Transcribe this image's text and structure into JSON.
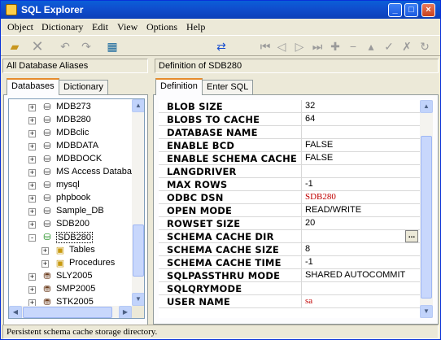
{
  "window": {
    "title": "SQL Explorer"
  },
  "menu": [
    "Object",
    "Dictionary",
    "Edit",
    "View",
    "Options",
    "Help"
  ],
  "toolbar": {
    "icons": [
      "open-folder-icon",
      "delete-icon",
      "undo-icon",
      "redo-icon",
      "dbdesk-icon",
      "synchronize-icon",
      "first-icon",
      "prior-icon",
      "next-icon",
      "last-icon",
      "insert-icon",
      "remove-icon",
      "edit-icon",
      "post-icon",
      "cancel-icon",
      "refresh-icon"
    ]
  },
  "left": {
    "header": "All Database Aliases",
    "tabs": [
      "Databases",
      "Dictionary"
    ],
    "tree": [
      {
        "label": "MDB273",
        "expander": "+",
        "type": "db"
      },
      {
        "label": "MDB280",
        "expander": "+",
        "type": "db"
      },
      {
        "label": "MDBclic",
        "expander": "+",
        "type": "db"
      },
      {
        "label": "MDBDATA",
        "expander": "+",
        "type": "db"
      },
      {
        "label": "MDBDOCK",
        "expander": "+",
        "type": "db"
      },
      {
        "label": "MS Access Databa",
        "expander": "+",
        "type": "db"
      },
      {
        "label": "mysql",
        "expander": "+",
        "type": "db"
      },
      {
        "label": "phpbook",
        "expander": "+",
        "type": "db"
      },
      {
        "label": "Sample_DB",
        "expander": "+",
        "type": "db"
      },
      {
        "label": "SDB200",
        "expander": "+",
        "type": "db"
      },
      {
        "label": "SDB280",
        "expander": "-",
        "type": "db-open"
      },
      {
        "label": "Tables",
        "expander": "+",
        "type": "folder",
        "child": true
      },
      {
        "label": "Procedures",
        "expander": "+",
        "type": "folder",
        "child": true
      },
      {
        "label": "SLY2005",
        "expander": "+",
        "type": "server"
      },
      {
        "label": "SMP2005",
        "expander": "+",
        "type": "server"
      },
      {
        "label": "STK2005",
        "expander": "+",
        "type": "server"
      }
    ]
  },
  "right": {
    "header": "Definition of SDB280",
    "tabs": [
      "Definition",
      "Enter SQL"
    ],
    "rows": [
      {
        "key": "BLOB SIZE",
        "value": "32"
      },
      {
        "key": "BLOBS TO CACHE",
        "value": "64"
      },
      {
        "key": "DATABASE NAME",
        "value": ""
      },
      {
        "key": "ENABLE BCD",
        "value": "FALSE"
      },
      {
        "key": "ENABLE SCHEMA CACHE",
        "value": "FALSE"
      },
      {
        "key": "LANGDRIVER",
        "value": ""
      },
      {
        "key": "MAX ROWS",
        "value": "-1"
      },
      {
        "key": "ODBC DSN",
        "value": "SDB280",
        "red": true
      },
      {
        "key": "OPEN MODE",
        "value": "READ/WRITE"
      },
      {
        "key": "ROWSET SIZE",
        "value": "20"
      },
      {
        "key": "SCHEMA CACHE DIR",
        "value": "",
        "ellipsis": "..."
      },
      {
        "key": "SCHEMA CACHE SIZE",
        "value": "8"
      },
      {
        "key": "SCHEMA CACHE TIME",
        "value": "-1"
      },
      {
        "key": "SQLPASSTHRU MODE",
        "value": "SHARED AUTOCOMMIT"
      },
      {
        "key": "SQLQRYMODE",
        "value": ""
      },
      {
        "key": "USER NAME",
        "value": "sa",
        "red": true
      }
    ]
  },
  "status": {
    "text": "Persistent schema cache storage directory."
  },
  "colors": {
    "titlebar": "#0b4fd0",
    "accent_tab": "#e68b2c",
    "red_value": "#c00000"
  }
}
